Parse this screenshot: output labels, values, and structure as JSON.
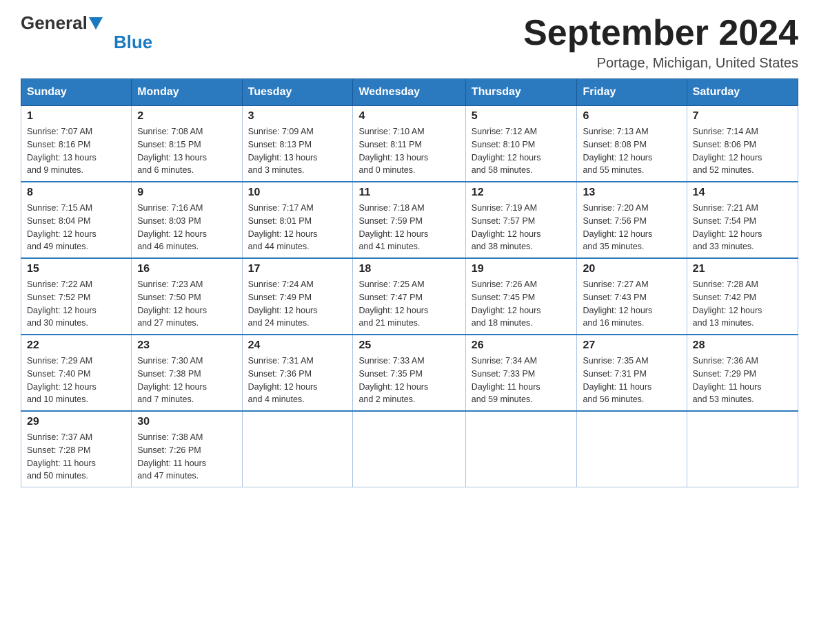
{
  "logo": {
    "general": "General",
    "blue": "Blue"
  },
  "title": "September 2024",
  "subtitle": "Portage, Michigan, United States",
  "headers": [
    "Sunday",
    "Monday",
    "Tuesday",
    "Wednesday",
    "Thursday",
    "Friday",
    "Saturday"
  ],
  "weeks": [
    [
      {
        "day": "1",
        "info": "Sunrise: 7:07 AM\nSunset: 8:16 PM\nDaylight: 13 hours\nand 9 minutes."
      },
      {
        "day": "2",
        "info": "Sunrise: 7:08 AM\nSunset: 8:15 PM\nDaylight: 13 hours\nand 6 minutes."
      },
      {
        "day": "3",
        "info": "Sunrise: 7:09 AM\nSunset: 8:13 PM\nDaylight: 13 hours\nand 3 minutes."
      },
      {
        "day": "4",
        "info": "Sunrise: 7:10 AM\nSunset: 8:11 PM\nDaylight: 13 hours\nand 0 minutes."
      },
      {
        "day": "5",
        "info": "Sunrise: 7:12 AM\nSunset: 8:10 PM\nDaylight: 12 hours\nand 58 minutes."
      },
      {
        "day": "6",
        "info": "Sunrise: 7:13 AM\nSunset: 8:08 PM\nDaylight: 12 hours\nand 55 minutes."
      },
      {
        "day": "7",
        "info": "Sunrise: 7:14 AM\nSunset: 8:06 PM\nDaylight: 12 hours\nand 52 minutes."
      }
    ],
    [
      {
        "day": "8",
        "info": "Sunrise: 7:15 AM\nSunset: 8:04 PM\nDaylight: 12 hours\nand 49 minutes."
      },
      {
        "day": "9",
        "info": "Sunrise: 7:16 AM\nSunset: 8:03 PM\nDaylight: 12 hours\nand 46 minutes."
      },
      {
        "day": "10",
        "info": "Sunrise: 7:17 AM\nSunset: 8:01 PM\nDaylight: 12 hours\nand 44 minutes."
      },
      {
        "day": "11",
        "info": "Sunrise: 7:18 AM\nSunset: 7:59 PM\nDaylight: 12 hours\nand 41 minutes."
      },
      {
        "day": "12",
        "info": "Sunrise: 7:19 AM\nSunset: 7:57 PM\nDaylight: 12 hours\nand 38 minutes."
      },
      {
        "day": "13",
        "info": "Sunrise: 7:20 AM\nSunset: 7:56 PM\nDaylight: 12 hours\nand 35 minutes."
      },
      {
        "day": "14",
        "info": "Sunrise: 7:21 AM\nSunset: 7:54 PM\nDaylight: 12 hours\nand 33 minutes."
      }
    ],
    [
      {
        "day": "15",
        "info": "Sunrise: 7:22 AM\nSunset: 7:52 PM\nDaylight: 12 hours\nand 30 minutes."
      },
      {
        "day": "16",
        "info": "Sunrise: 7:23 AM\nSunset: 7:50 PM\nDaylight: 12 hours\nand 27 minutes."
      },
      {
        "day": "17",
        "info": "Sunrise: 7:24 AM\nSunset: 7:49 PM\nDaylight: 12 hours\nand 24 minutes."
      },
      {
        "day": "18",
        "info": "Sunrise: 7:25 AM\nSunset: 7:47 PM\nDaylight: 12 hours\nand 21 minutes."
      },
      {
        "day": "19",
        "info": "Sunrise: 7:26 AM\nSunset: 7:45 PM\nDaylight: 12 hours\nand 18 minutes."
      },
      {
        "day": "20",
        "info": "Sunrise: 7:27 AM\nSunset: 7:43 PM\nDaylight: 12 hours\nand 16 minutes."
      },
      {
        "day": "21",
        "info": "Sunrise: 7:28 AM\nSunset: 7:42 PM\nDaylight: 12 hours\nand 13 minutes."
      }
    ],
    [
      {
        "day": "22",
        "info": "Sunrise: 7:29 AM\nSunset: 7:40 PM\nDaylight: 12 hours\nand 10 minutes."
      },
      {
        "day": "23",
        "info": "Sunrise: 7:30 AM\nSunset: 7:38 PM\nDaylight: 12 hours\nand 7 minutes."
      },
      {
        "day": "24",
        "info": "Sunrise: 7:31 AM\nSunset: 7:36 PM\nDaylight: 12 hours\nand 4 minutes."
      },
      {
        "day": "25",
        "info": "Sunrise: 7:33 AM\nSunset: 7:35 PM\nDaylight: 12 hours\nand 2 minutes."
      },
      {
        "day": "26",
        "info": "Sunrise: 7:34 AM\nSunset: 7:33 PM\nDaylight: 11 hours\nand 59 minutes."
      },
      {
        "day": "27",
        "info": "Sunrise: 7:35 AM\nSunset: 7:31 PM\nDaylight: 11 hours\nand 56 minutes."
      },
      {
        "day": "28",
        "info": "Sunrise: 7:36 AM\nSunset: 7:29 PM\nDaylight: 11 hours\nand 53 minutes."
      }
    ],
    [
      {
        "day": "29",
        "info": "Sunrise: 7:37 AM\nSunset: 7:28 PM\nDaylight: 11 hours\nand 50 minutes."
      },
      {
        "day": "30",
        "info": "Sunrise: 7:38 AM\nSunset: 7:26 PM\nDaylight: 11 hours\nand 47 minutes."
      },
      null,
      null,
      null,
      null,
      null
    ]
  ]
}
